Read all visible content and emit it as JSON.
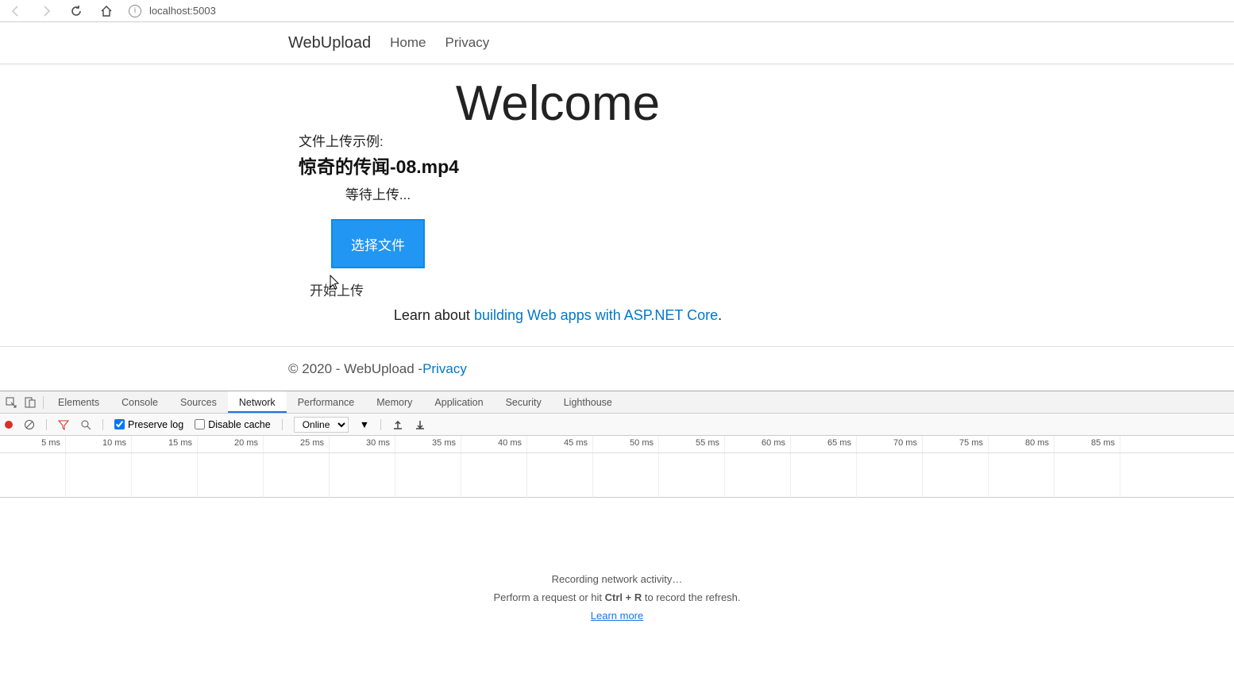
{
  "browser": {
    "url": "localhost:5003"
  },
  "navbar": {
    "brand": "WebUpload",
    "links": [
      "Home",
      "Privacy"
    ]
  },
  "page": {
    "welcome": "Welcome",
    "upload_example_label": "文件上传示例:",
    "filename": "惊奇的传闻-08.mp4",
    "status": "等待上传...",
    "select_file_btn": "选择文件",
    "start_upload": "开始上传",
    "learn_prefix": "Learn about ",
    "learn_link": "building Web apps with ASP.NET Core",
    "learn_suffix": "."
  },
  "footer": {
    "copyright": "© 2020 - WebUpload - ",
    "privacy": "Privacy"
  },
  "devtools": {
    "tabs": [
      "Elements",
      "Console",
      "Sources",
      "Network",
      "Performance",
      "Memory",
      "Application",
      "Security",
      "Lighthouse"
    ],
    "active_tab": "Network",
    "preserve_log": "Preserve log",
    "disable_cache": "Disable cache",
    "throttling": "Online",
    "timeline_ticks": [
      "5 ms",
      "10 ms",
      "15 ms",
      "20 ms",
      "25 ms",
      "30 ms",
      "35 ms",
      "40 ms",
      "45 ms",
      "50 ms",
      "55 ms",
      "60 ms",
      "65 ms",
      "70 ms",
      "75 ms",
      "80 ms",
      "85 ms"
    ],
    "empty_title": "Recording network activity…",
    "empty_hint_prefix": "Perform a request or hit ",
    "empty_hint_key": "Ctrl + R",
    "empty_hint_suffix": " to record the refresh.",
    "learn_more": "Learn more"
  }
}
